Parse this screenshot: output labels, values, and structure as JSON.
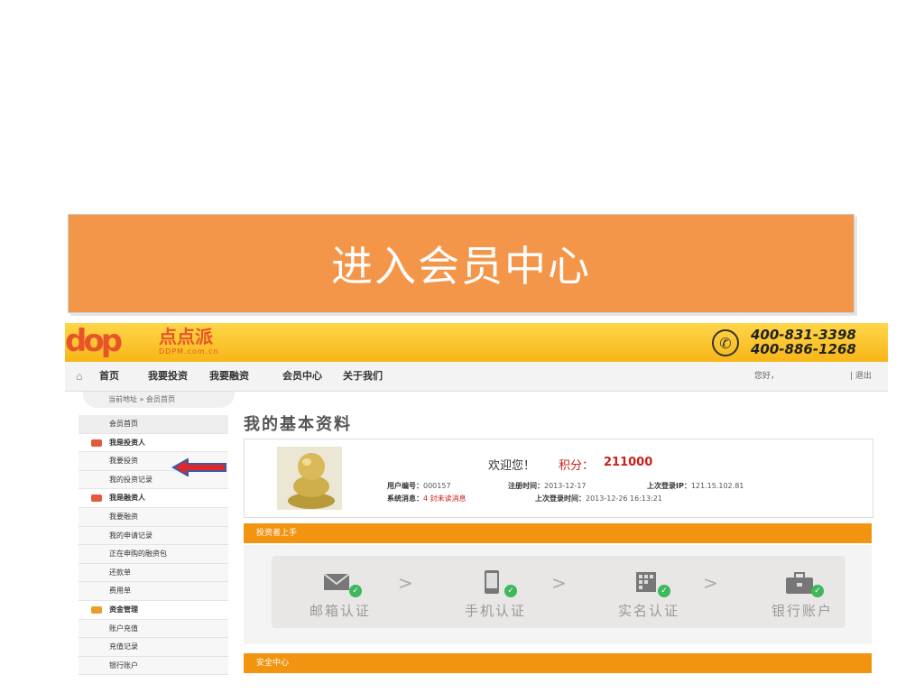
{
  "slide": {
    "title": "进入会员中心"
  },
  "site": {
    "logo_mark": "dop",
    "logo_name": "点点派",
    "logo_url": "DDPM.com.cn",
    "phones": [
      "400-831-3398",
      "400-886-1268"
    ]
  },
  "nav": {
    "items": [
      "首页",
      "我要投资",
      "我要融资",
      "会员中心",
      "关于我们"
    ],
    "greeting": "您好，",
    "logout": "| 退出"
  },
  "breadcrumb": "当前地址 » 会员首页",
  "sidebar": {
    "items": [
      {
        "label": "会员首页",
        "type": "first"
      },
      {
        "label": "我是投资人",
        "type": "head"
      },
      {
        "label": "我要投资",
        "type": "item"
      },
      {
        "label": "我的投资记录",
        "type": "item"
      },
      {
        "label": "我是融资人",
        "type": "head"
      },
      {
        "label": "我要融资",
        "type": "item"
      },
      {
        "label": "我的申请记录",
        "type": "item"
      },
      {
        "label": "正在申购的融资包",
        "type": "item"
      },
      {
        "label": "还款单",
        "type": "item"
      },
      {
        "label": "费用单",
        "type": "item"
      },
      {
        "label": "资金管理",
        "type": "head"
      },
      {
        "label": "账户充值",
        "type": "item"
      },
      {
        "label": "充值记录",
        "type": "item"
      },
      {
        "label": "银行账户",
        "type": "item"
      }
    ]
  },
  "profile": {
    "title": "我的基本资料",
    "welcome": "欢迎您！",
    "points_label": "积分：",
    "points": "211000",
    "user_id_label": "用户编号：",
    "user_id": "000157",
    "reg_label": "注册时间：",
    "reg_date": "2013-12-17",
    "ip_label": "上次登录IP：",
    "ip": "121.15.102.81",
    "msg_label": "系统消息：",
    "msg": "4 封未读消息",
    "last_login_label": "上次登录时间：",
    "last_login": "2013-12-26 16:13:21"
  },
  "sections": {
    "investor": "投资者上手",
    "security": "安全中心"
  },
  "steps": [
    {
      "label": "邮箱认证",
      "icon": "envelope-icon"
    },
    {
      "label": "手机认证",
      "icon": "mobile-phone-icon"
    },
    {
      "label": "实名认证",
      "icon": "id-card-icon"
    },
    {
      "label": "银行账户",
      "icon": "briefcase-icon"
    }
  ],
  "step_separator": ">",
  "colors": {
    "banner": "#f4964a",
    "topbar": "#f7b618",
    "section_bar": "#f29410",
    "accent_red": "#c8201a",
    "check_green": "#3db85a"
  }
}
